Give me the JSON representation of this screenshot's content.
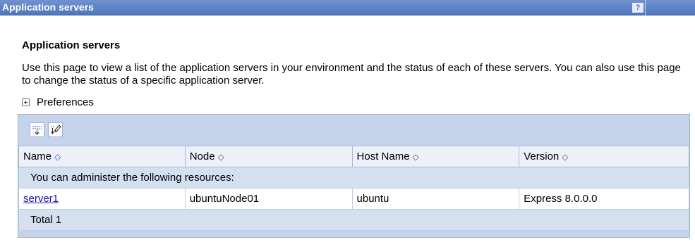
{
  "window": {
    "title": "Application servers",
    "help_label": "?"
  },
  "page": {
    "heading": "Application servers",
    "description": "Use this page to view a list of the application servers in your environment and the status of each of these servers. You can also use this page to change the status of a specific application server.",
    "preferences_label": "Preferences"
  },
  "toolbar": {
    "buttons": [
      {
        "icon": "select-all-icon"
      },
      {
        "icon": "deselect-all-icon"
      }
    ]
  },
  "table": {
    "columns": [
      "Name",
      "Node",
      "Host Name",
      "Version"
    ],
    "sort_glyph": "◇",
    "notice": "You can administer the following resources:",
    "rows": [
      {
        "name": "server1",
        "node": "ubuntuNode01",
        "host": "ubuntu",
        "version": "Express 8.0.0.0"
      }
    ],
    "total": "Total 1"
  }
}
